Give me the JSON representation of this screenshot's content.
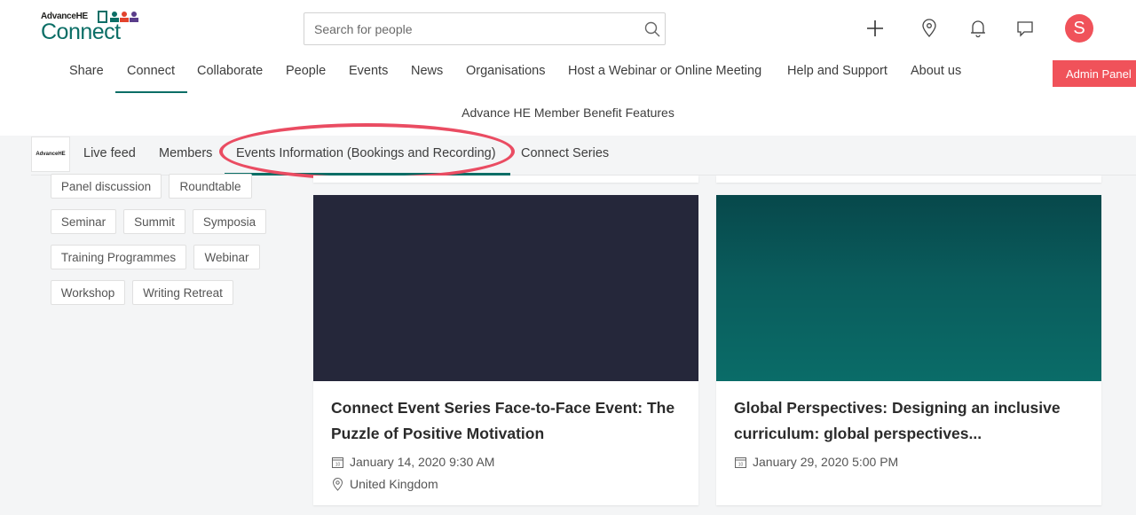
{
  "brand": {
    "small_text": "AdvanceHE",
    "big_text": "Connect"
  },
  "search": {
    "placeholder": "Search for people"
  },
  "header_icons": [
    "plus-icon",
    "location-icon",
    "bell-icon",
    "chat-icon"
  ],
  "avatar": {
    "letter": "S",
    "color": "#f0525a"
  },
  "main_nav": {
    "items": [
      "Share",
      "Connect",
      "Collaborate",
      "People",
      "Events",
      "News",
      "Organisations",
      "Host a Webinar or Online Meeting",
      "Help and Support",
      "About us"
    ],
    "active": "Connect"
  },
  "admin_button": "Admin Panel",
  "sub_nav": "Advance HE Member Benefit Features",
  "group": {
    "logo_text": "AdvanceHE",
    "tabs": [
      "Live feed",
      "Members",
      "Events Information (Bookings and Recording)",
      "Connect Series"
    ],
    "active_tab": "Events Information (Bookings and Recording)"
  },
  "filter_tags": [
    "Panel discussion",
    "Roundtable",
    "Seminar",
    "Summit",
    "Symposia",
    "Training Programmes",
    "Webinar",
    "Workshop",
    "Writing Retreat"
  ],
  "events": [
    {
      "title": "Connect Event Series Face-to-Face Event: The Puzzle of Positive Motivation",
      "date": "January 14, 2020 9:30 AM",
      "location": "United Kingdom",
      "image_color": "#25273a"
    },
    {
      "title": "Global Perspectives: Designing an inclusive curriculum: global perspectives...",
      "date": "January 29, 2020 5:00 PM",
      "image_color": "#0a5c5c"
    }
  ],
  "colors": {
    "brand_teal": "#0b6e66",
    "accent_red": "#f0525a",
    "highlight": "#ea4c62"
  }
}
